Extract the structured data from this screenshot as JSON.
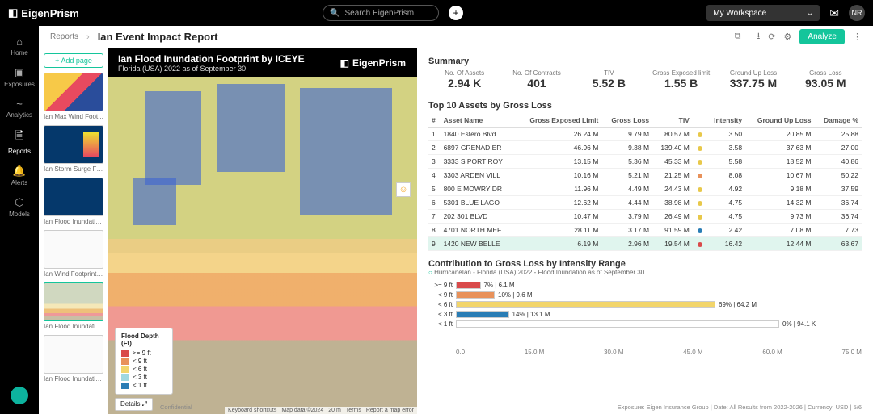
{
  "brand": "EigenPrism",
  "search_placeholder": "Search EigenPrism",
  "workspace": "My Workspace",
  "avatar": "NR",
  "rail": [
    {
      "icon": "⌂",
      "label": "Home"
    },
    {
      "icon": "▣",
      "label": "Exposures"
    },
    {
      "icon": "~",
      "label": "Analytics"
    },
    {
      "icon": "🗎",
      "label": "Reports"
    },
    {
      "icon": "🔔",
      "label": "Alerts"
    },
    {
      "icon": "⬡",
      "label": "Models"
    }
  ],
  "breadcrumb": "Reports",
  "page_title": "Ian Event Impact Report",
  "analyze": "Analyze",
  "add_page": "+ Add page",
  "thumbs": [
    "Ian Max Wind Foot...",
    "Ian Storm Surge Fo...",
    "Ian Flood Inundatio...",
    "Ian Wind Footprint ...",
    "Ian Flood Inundatio...",
    "Ian Flood Inundatio..."
  ],
  "map_title": "Ian Flood Inundation Footprint by ICEYE",
  "map_sub": "Florida (USA) 2022 as of September 30",
  "map_brand": "EigenPrism",
  "legend_title": "Flood Depth (Ft)",
  "legend": [
    {
      "c": "#d94a4a",
      "t": ">= 9 ft"
    },
    {
      "c": "#e8915a",
      "t": "< 9 ft"
    },
    {
      "c": "#f2d56b",
      "t": "< 6 ft"
    },
    {
      "c": "#9fd8e0",
      "t": "< 3 ft"
    },
    {
      "c": "#2a7db5",
      "t": "< 1 ft"
    }
  ],
  "details": "Details",
  "map_footer": [
    "Keyboard shortcuts",
    "Map data ©2024",
    "20 m",
    "Terms",
    "Report a map error"
  ],
  "summary_heading": "Summary",
  "summary": [
    {
      "lab": "No. Of Assets",
      "val": "2.94 K"
    },
    {
      "lab": "No. Of Contracts",
      "val": "401"
    },
    {
      "lab": "TIV",
      "val": "5.52 B"
    },
    {
      "lab": "Gross Exposed limit",
      "val": "1.55 B"
    },
    {
      "lab": "Ground Up Loss",
      "val": "337.75 M"
    },
    {
      "lab": "Gross Loss",
      "val": "93.05 M"
    }
  ],
  "table_title": "Top 10 Assets by Gross Loss",
  "columns": [
    "#",
    "Asset Name",
    "Gross Exposed Limit",
    "Gross Loss",
    "TIV",
    "",
    "Intensity",
    "Ground Up Loss",
    "Damage %"
  ],
  "rows": [
    {
      "n": "1",
      "name": "1840 Estero Blvd",
      "gel": "26.24 M",
      "gl": "9.79 M",
      "tiv": "80.57 M",
      "dot": "#e8c84a",
      "int": "3.50",
      "gul": "20.85 M",
      "dmg": "25.88"
    },
    {
      "n": "2",
      "name": "6897 GRENADIER",
      "gel": "46.96 M",
      "gl": "9.38 M",
      "tiv": "139.40 M",
      "dot": "#e8c84a",
      "int": "3.58",
      "gul": "37.63 M",
      "dmg": "27.00"
    },
    {
      "n": "3",
      "name": "3333 S PORT ROY",
      "gel": "13.15 M",
      "gl": "5.36 M",
      "tiv": "45.33 M",
      "dot": "#e8c84a",
      "int": "5.58",
      "gul": "18.52 M",
      "dmg": "40.86"
    },
    {
      "n": "4",
      "name": "3303 ARDEN VILL",
      "gel": "10.16 M",
      "gl": "5.21 M",
      "tiv": "21.25 M",
      "dot": "#e8915a",
      "int": "8.08",
      "gul": "10.67 M",
      "dmg": "50.22"
    },
    {
      "n": "5",
      "name": "800 E MOWRY DR",
      "gel": "11.96 M",
      "gl": "4.49 M",
      "tiv": "24.43 M",
      "dot": "#e8c84a",
      "int": "4.92",
      "gul": "9.18 M",
      "dmg": "37.59"
    },
    {
      "n": "6",
      "name": "5301 BLUE LAGO",
      "gel": "12.62 M",
      "gl": "4.44 M",
      "tiv": "38.98 M",
      "dot": "#e8c84a",
      "int": "4.75",
      "gul": "14.32 M",
      "dmg": "36.74"
    },
    {
      "n": "7",
      "name": "202 301 BLVD",
      "gel": "10.47 M",
      "gl": "3.79 M",
      "tiv": "26.49 M",
      "dot": "#e8c84a",
      "int": "4.75",
      "gul": "9.73 M",
      "dmg": "36.74"
    },
    {
      "n": "8",
      "name": "4701 NORTH MEF",
      "gel": "28.11 M",
      "gl": "3.17 M",
      "tiv": "91.59 M",
      "dot": "#2a7db5",
      "int": "2.42",
      "gul": "7.08 M",
      "dmg": "7.73"
    },
    {
      "n": "9",
      "name": "1420 NEW BELLE",
      "gel": "6.19 M",
      "gl": "2.96 M",
      "tiv": "19.54 M",
      "dot": "#d94a4a",
      "int": "16.42",
      "gul": "12.44 M",
      "dmg": "63.67",
      "hl": true
    }
  ],
  "contrib_title": "Contribution to Gross Loss by Intensity Range",
  "contrib_sub": "HurricaneIan - Florida (USA) 2022 - Flood Inundation as of September 30",
  "chart_data": {
    "type": "bar",
    "orientation": "horizontal",
    "xlabel": "",
    "ylabel": "",
    "xlim": [
      0,
      80
    ],
    "categories": [
      ">= 9 ft",
      "< 9 ft",
      "< 6 ft",
      "< 3 ft",
      "< 1 ft"
    ],
    "series": [
      {
        "name": "Gross Loss (M)",
        "values": [
          6.1,
          9.6,
          64.2,
          13.1,
          94.1
        ]
      }
    ],
    "bar_colors": [
      "#d94a4a",
      "#e8915a",
      "#f2d56b",
      "#2a7db5",
      "#ffffff"
    ],
    "percent": [
      7,
      10,
      69,
      14,
      0
    ],
    "data_labels": [
      "7% | 6.1 M",
      "10% | 9.6 M",
      "69% | 64.2 M",
      "14% | 13.1 M",
      "0% | 94.1 K"
    ],
    "ticks": [
      "0.0",
      "15.0 M",
      "30.0 M",
      "45.0 M",
      "60.0 M",
      "75.0 M"
    ]
  },
  "footer_meta": "Exposure: Eigen Insurance Group | Date: All Results from 2022-2026 | Currency: USD | 5/6",
  "confidential": "Confidential"
}
